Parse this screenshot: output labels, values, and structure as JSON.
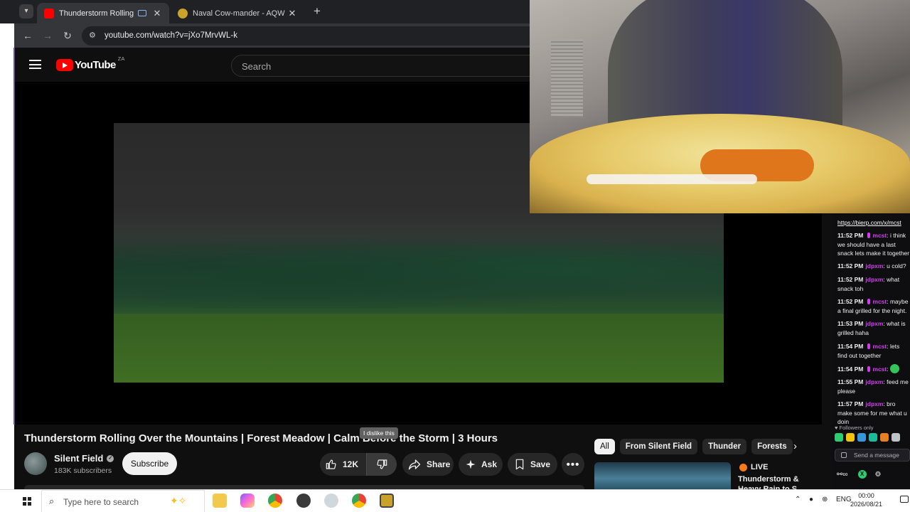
{
  "browser": {
    "tabs": [
      {
        "title": "Thunderstorm Rolling Over the Mountains | Forest Meadow",
        "active": true
      },
      {
        "title": "Naval Cow-mander - AQW",
        "active": false
      }
    ],
    "url": "youtube.com/watch?v=jXo7MrvWL-k"
  },
  "youtube": {
    "logo_text": "YouTube",
    "country_code": "ZA",
    "search_placeholder": "Search",
    "video_title": "Thunderstorm Rolling Over the Mountains | Forest Meadow | Calm Before the Storm | 3 Hours",
    "tooltip": "I dislike this",
    "channel": {
      "name": "Silent Field",
      "subscribers": "183K subscribers"
    },
    "subscribe_label": "Subscribe",
    "actions": {
      "likes": "12K",
      "share": "Share",
      "ask": "Ask",
      "save": "Save"
    },
    "chips": [
      "All",
      "From Silent Field",
      "Thunder",
      "Forests"
    ],
    "recommended": {
      "badge": "LIVE",
      "title": "Thunderstorm & Heavy Rain to S..."
    }
  },
  "chat": {
    "top_link": "https://bierp.com/x/mcst",
    "messages": [
      {
        "time": "11:52 PM",
        "user": "mcst",
        "color": "pink",
        "text": "i think we should have a last snack lets make it together"
      },
      {
        "time": "11:52 PM",
        "user": "jdpxm",
        "color": "pink",
        "text": "u cold?"
      },
      {
        "time": "11:52 PM",
        "user": "jdpxm",
        "color": "pink",
        "text": "what snack toh"
      },
      {
        "time": "11:52 PM",
        "user": "mcst",
        "color": "pink",
        "text": "maybe a final grilled for the night."
      },
      {
        "time": "11:53 PM",
        "user": "jdpxm",
        "color": "pink",
        "text": "what is grilled haha"
      },
      {
        "time": "11:54 PM",
        "user": "mcst",
        "color": "pink",
        "text": "lets find out together"
      },
      {
        "time": "11:54 PM",
        "user": "mcst",
        "color": "pink",
        "text": ""
      },
      {
        "time": "11:55 PM",
        "user": "jdpxm",
        "color": "pink",
        "text": "feed me please"
      },
      {
        "time": "11:57 PM",
        "user": "jdpxm",
        "color": "pink",
        "text": "bro make some for me what u doin"
      }
    ],
    "followers_only": "Followers only",
    "send_placeholder": "Send a message"
  },
  "taskbar": {
    "search_placeholder": "Type here to search",
    "language": "ENG",
    "time": "00:00",
    "date": "2026/08/21"
  }
}
